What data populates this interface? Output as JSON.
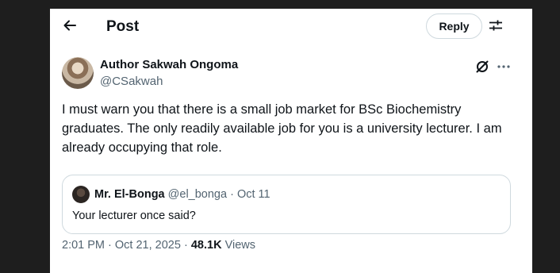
{
  "header": {
    "title": "Post",
    "reply_label": "Reply"
  },
  "post": {
    "author_name": "Author Sakwah Ongoma",
    "author_handle": "@CSakwah",
    "text": "I must warn you that there is a small job market for BSc Biochemistry graduates. The only readily available job for you is a university lecturer. I am already occupying that role.",
    "time": "2:01 PM",
    "date": "Oct 21, 2025",
    "views_count": "48.1K",
    "views_label": "Views",
    "separator": "·"
  },
  "quote": {
    "author_name": "Mr. El-Bonga",
    "author_handle": "@el_bonga",
    "date": "Oct 11",
    "separator": "·",
    "text": "Your lecturer once said?"
  },
  "icons": {
    "back": "arrow-left-icon",
    "adjust": "sliders-icon",
    "grok": "grok-icon",
    "more": "more-horizontal-icon"
  },
  "colors": {
    "text_primary": "#0f1419",
    "text_secondary": "#536471",
    "border": "#cfd9de",
    "background_outer": "#1e1e1e",
    "background_panel": "#ffffff"
  }
}
